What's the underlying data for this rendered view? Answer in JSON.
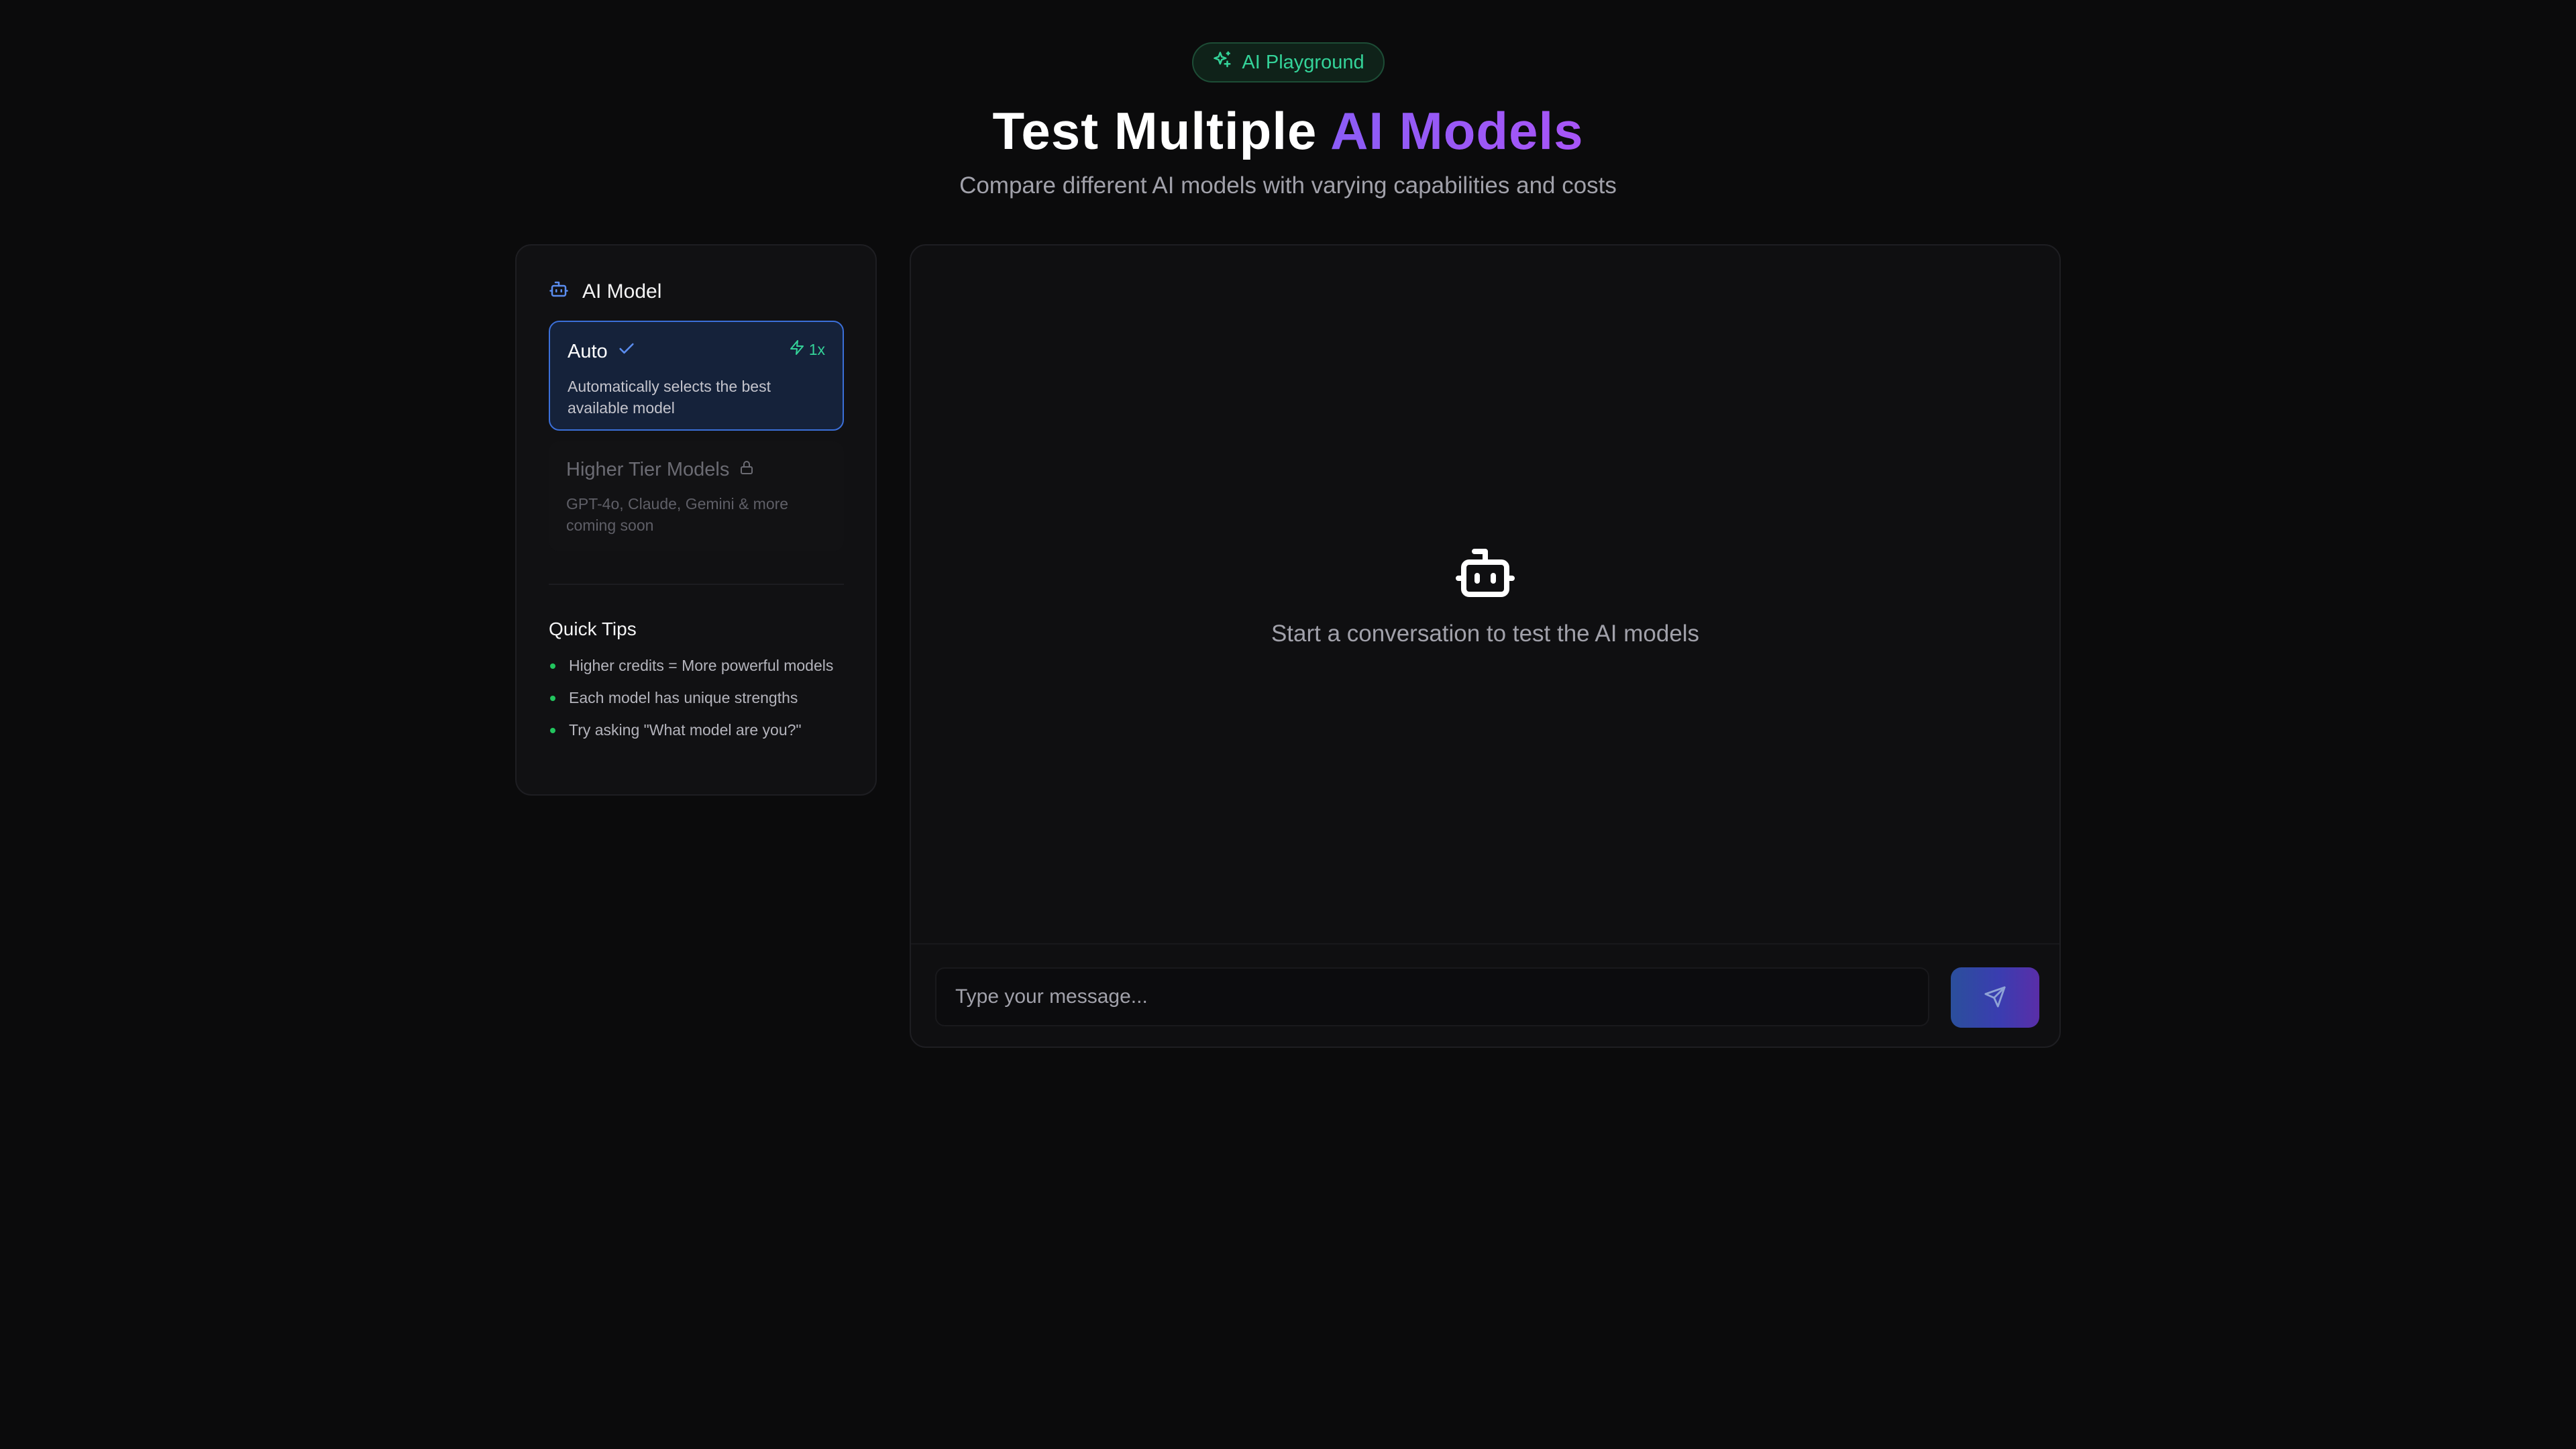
{
  "header": {
    "badge_label": "AI Playground",
    "title_main": "Test Multiple ",
    "title_accent": "AI Models",
    "subtitle": "Compare different AI models with varying capabilities and costs"
  },
  "sidebar": {
    "heading": "AI Model",
    "selected_model": {
      "name": "Auto",
      "credit": "1x",
      "description": "Automatically selects the best available model"
    },
    "locked_model": {
      "name": "Higher Tier Models",
      "description": "GPT-4o, Claude, Gemini & more coming soon"
    },
    "tips_heading": "Quick Tips",
    "tips": [
      "Higher credits = More powerful models",
      "Each model has unique strengths",
      "Try asking \"What model are you?\""
    ]
  },
  "chat": {
    "empty_text": "Start a conversation to test the AI models",
    "input_placeholder": "Type your message...",
    "input_value": ""
  },
  "colors": {
    "accent_green": "#34d399",
    "accent_purple": "#8b5cf6",
    "selected_border": "#3b6fd8",
    "background": "#0b0b0c"
  },
  "icons": {
    "badge": "sparkles-icon",
    "model_heading": "bot-icon",
    "selected": "check-icon",
    "credit": "zap-icon",
    "locked": "lock-icon",
    "empty_state": "bot-icon",
    "send": "send-icon"
  }
}
